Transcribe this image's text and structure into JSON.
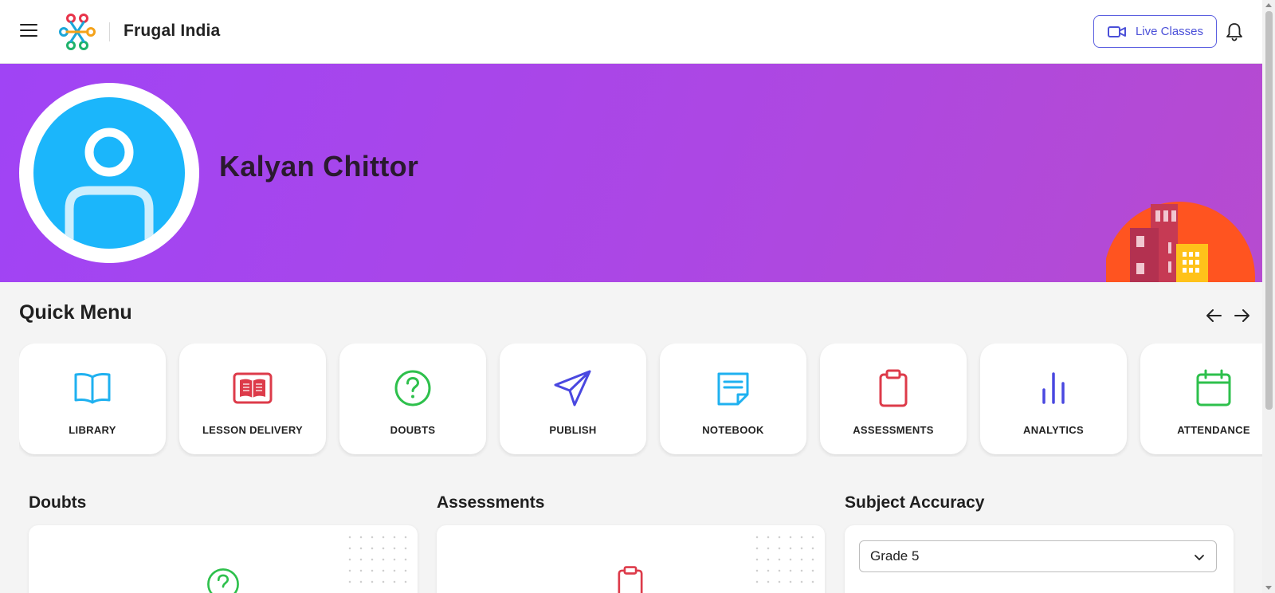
{
  "header": {
    "brand": "Frugal India",
    "live_classes_label": "Live Classes"
  },
  "hero": {
    "name": "Kalyan Chittor"
  },
  "quick_menu": {
    "title": "Quick Menu",
    "items": [
      {
        "label": "LIBRARY",
        "icon": "book-icon",
        "color": "#1fb1f0"
      },
      {
        "label": "LESSON DELIVERY",
        "icon": "lesson-book-icon",
        "color": "#dd3b4a"
      },
      {
        "label": "DOUBTS",
        "icon": "question-circle-icon",
        "color": "#2ec04c"
      },
      {
        "label": "PUBLISH",
        "icon": "send-icon",
        "color": "#4a48e0"
      },
      {
        "label": "NOTEBOOK",
        "icon": "notebook-icon",
        "color": "#1fb1f0"
      },
      {
        "label": "ASSESSMENTS",
        "icon": "clipboard-icon",
        "color": "#dd3b4a"
      },
      {
        "label": "ANALYTICS",
        "icon": "bar-chart-icon",
        "color": "#4a48e0"
      },
      {
        "label": "ATTENDANCE",
        "icon": "calendar-icon",
        "color": "#2ec04c"
      }
    ]
  },
  "sections": {
    "doubts_title": "Doubts",
    "assessments_title": "Assessments",
    "subject_accuracy_title": "Subject Accuracy",
    "grade_select_value": "Grade 5"
  },
  "colors": {
    "accent": "#4b50d8",
    "hero_gradient_start": "#a044f5",
    "hero_gradient_end": "#b64bd0",
    "avatar_bg": "#1bb6fb"
  }
}
